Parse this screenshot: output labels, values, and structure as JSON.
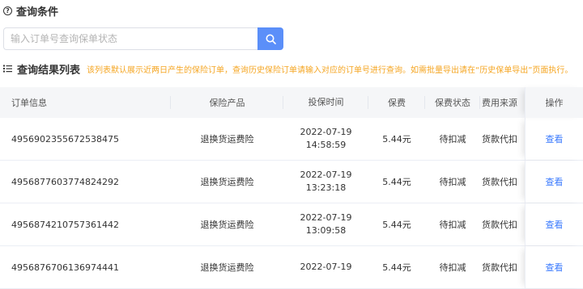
{
  "query_section": {
    "title": "查询条件"
  },
  "search": {
    "placeholder": "输入订单号查询保单状态",
    "value": ""
  },
  "results_section": {
    "title": "查询结果列表",
    "note": "该列表默认展示近两日产生的保险订单，查询历史保险订单请输入对应的订单号进行查询。如需批量导出请在“历史保单导出”页面执行。"
  },
  "table": {
    "headers": [
      "订单信息",
      "保险产品",
      "投保时间",
      "保费",
      "保费状态",
      "费用来源",
      "操作"
    ],
    "rows": [
      {
        "order": "4956902355672538475",
        "product": "退换货运费险",
        "date": "2022-07-19",
        "time": "14:58:59",
        "premium": "5.44元",
        "status": "待扣减",
        "source": "货款代扣",
        "action": "查看"
      },
      {
        "order": "4956877603774824292",
        "product": "退换货运费险",
        "date": "2022-07-19",
        "time": "13:23:18",
        "premium": "5.44元",
        "status": "待扣减",
        "source": "货款代扣",
        "action": "查看"
      },
      {
        "order": "4956874210757361442",
        "product": "退换货运费险",
        "date": "2022-07-19",
        "time": "13:09:58",
        "premium": "5.44元",
        "status": "待扣减",
        "source": "货款代扣",
        "action": "查看"
      },
      {
        "order": "4956876706136974441",
        "product": "退换货运费险",
        "date": "2022-07-19",
        "time": "",
        "premium": "5.44元",
        "status": "待扣减",
        "source": "货款代扣",
        "action": "查看"
      }
    ]
  }
}
